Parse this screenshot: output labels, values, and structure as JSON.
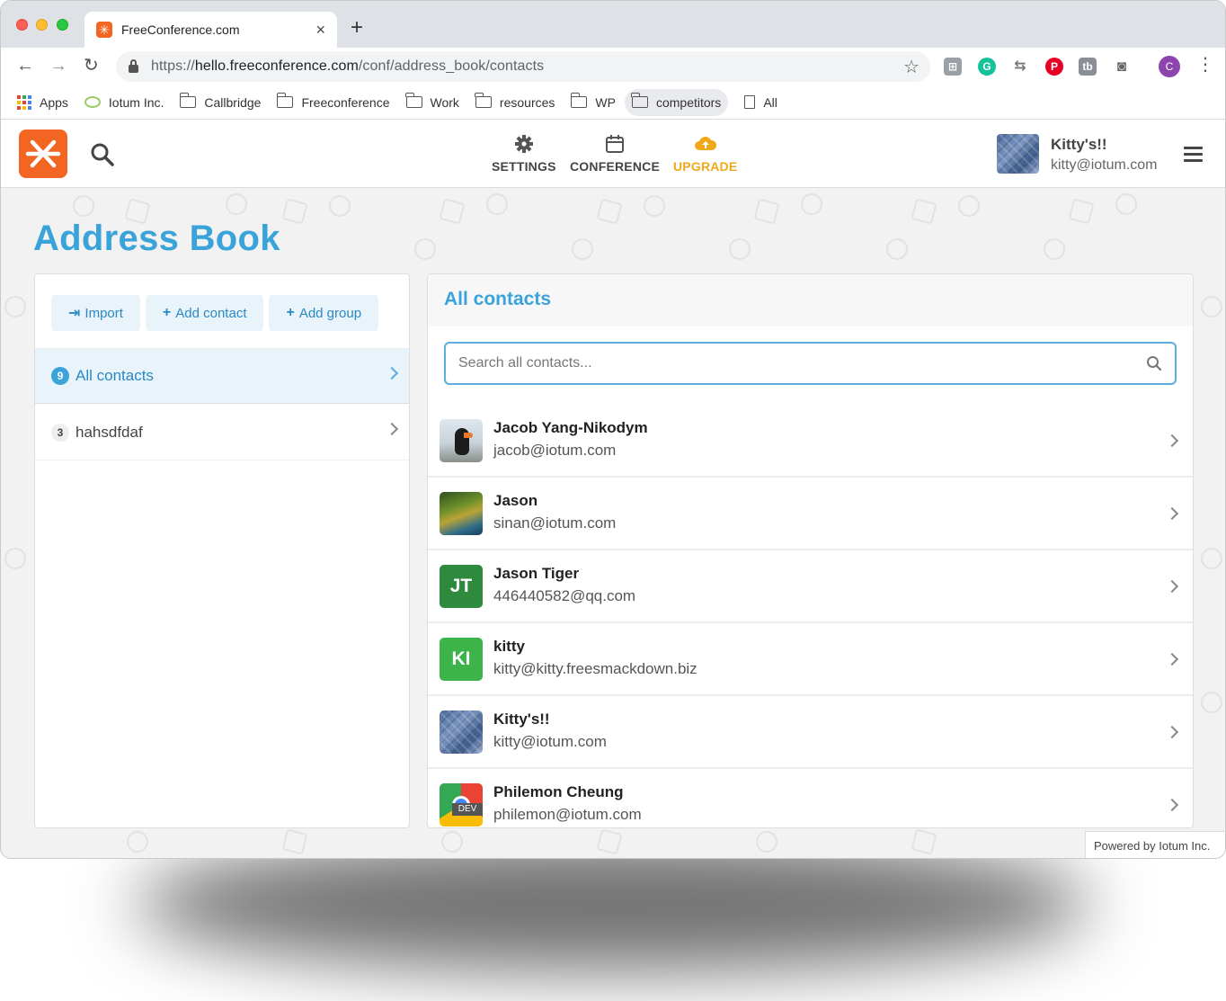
{
  "browser": {
    "tab_title": "FreeConference.com",
    "url_scheme": "https://",
    "url_host": "hello.freeconference.com",
    "url_path": "/conf/address_book/contacts",
    "profile_initial": "C",
    "bookmarks": [
      {
        "label": "Apps",
        "icon": "apps-grid-icon"
      },
      {
        "label": "Iotum Inc.",
        "icon": "bubble-icon"
      },
      {
        "label": "Callbridge",
        "icon": "folder-icon"
      },
      {
        "label": "Freeconference",
        "icon": "folder-icon"
      },
      {
        "label": "Work",
        "icon": "folder-icon"
      },
      {
        "label": "resources",
        "icon": "folder-icon"
      },
      {
        "label": "WP",
        "icon": "folder-icon"
      },
      {
        "label": "competitors",
        "icon": "folder-icon"
      },
      {
        "label": "All",
        "icon": "page-icon"
      }
    ]
  },
  "header": {
    "nav": [
      {
        "label": "SETTINGS",
        "icon": "gear-icon"
      },
      {
        "label": "CONFERENCE",
        "icon": "calendar-icon"
      },
      {
        "label": "UPGRADE",
        "icon": "cloud-upload-icon"
      }
    ],
    "user_name": "Kitty's!!",
    "user_email": "kitty@iotum.com"
  },
  "page": {
    "title": "Address Book",
    "buttons": {
      "import": "Import",
      "add_contact": "Add contact",
      "add_group": "Add group"
    },
    "groups": [
      {
        "count": "9",
        "name": "All contacts"
      },
      {
        "count": "3",
        "name": "hahsdfdaf"
      }
    ],
    "list_title": "All contacts",
    "search_placeholder": "Search all contacts...",
    "contacts": [
      {
        "name": "Jacob Yang-Nikodym",
        "email": "jacob@iotum.com",
        "initials": ""
      },
      {
        "name": "Jason",
        "email": "sinan@iotum.com",
        "initials": ""
      },
      {
        "name": "Jason Tiger",
        "email": "446440582@qq.com",
        "initials": "JT"
      },
      {
        "name": "kitty",
        "email": "kitty@kitty.freesmackdown.biz",
        "initials": "KI"
      },
      {
        "name": "Kitty's!!",
        "email": "kitty@iotum.com",
        "initials": ""
      },
      {
        "name": "Philemon Cheung",
        "email": "philemon@iotum.com",
        "initials": "",
        "avatar_tag": "DEV"
      }
    ]
  },
  "footer": {
    "powered_by": "Powered by Iotum Inc."
  },
  "colors": {
    "brand": "#f26522",
    "accent": "#3aa3d9",
    "upgrade": "#f0a818",
    "avatar_jt": "#2e8b3e",
    "avatar_ki": "#3cb44a"
  }
}
